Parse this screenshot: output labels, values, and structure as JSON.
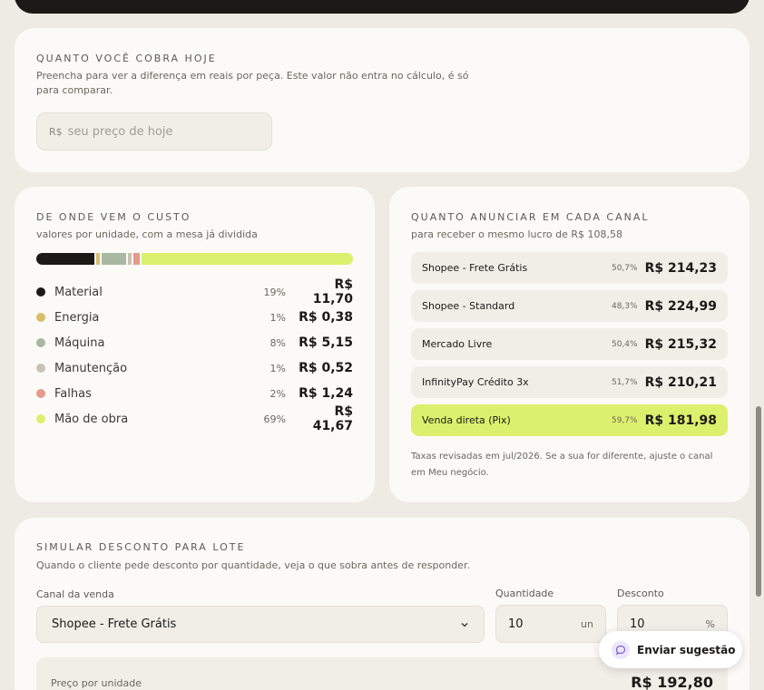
{
  "current_price": {
    "title": "QUANTO VOCÊ COBRA HOJE",
    "description": "Preencha para ver a diferença em reais por peça. Este valor não entra no cálculo, é só para comparar.",
    "prefix": "R$",
    "placeholder": "seu preço de hoje"
  },
  "cost_breakdown": {
    "title": "DE ONDE VEM O CUSTO",
    "subtitle": "valores por unidade, com a mesa já dividida",
    "items": [
      {
        "name": "Material",
        "pct": "19%",
        "value": "R$ 11,70",
        "share": 19,
        "color": "#1c1a17"
      },
      {
        "name": "Energia",
        "pct": "1%",
        "value": "R$ 0,38",
        "share": 1,
        "color": "#d9bd6a"
      },
      {
        "name": "Máquina",
        "pct": "8%",
        "value": "R$ 5,15",
        "share": 8,
        "color": "#a9b8a0"
      },
      {
        "name": "Manutenção",
        "pct": "1%",
        "value": "R$ 0,52",
        "share": 1,
        "color": "#c9c3b5"
      },
      {
        "name": "Falhas",
        "pct": "2%",
        "value": "R$ 1,24",
        "share": 2,
        "color": "#e59a8a"
      },
      {
        "name": "Mão de obra",
        "pct": "69%",
        "value": "R$ 41,67",
        "share": 69,
        "color": "#dbf06c"
      }
    ]
  },
  "channels": {
    "title": "QUANTO ANUNCIAR EM CADA CANAL",
    "subtitle": "para receber o mesmo lucro de R$ 108,58",
    "items": [
      {
        "name": "Shopee - Frete Grátis",
        "pct": "50,7%",
        "value": "R$ 214,23"
      },
      {
        "name": "Shopee - Standard",
        "pct": "48,3%",
        "value": "R$ 224,99"
      },
      {
        "name": "Mercado Livre",
        "pct": "50,4%",
        "value": "R$ 215,32"
      },
      {
        "name": "InfinityPay Crédito 3x",
        "pct": "51,7%",
        "value": "R$ 210,21"
      },
      {
        "name": "Venda direta (Pix)",
        "pct": "59,7%",
        "value": "R$ 181,98",
        "highlighted": true
      }
    ],
    "note": "Taxas revisadas em jul/2026. Se a sua for diferente, ajuste o canal em Meu negócio."
  },
  "simulator": {
    "title": "SIMULAR DESCONTO PARA LOTE",
    "subtitle": "Quando o cliente pede desconto por quantidade, veja o que sobra antes de responder.",
    "channel_label": "Canal da venda",
    "channel_value": "Shopee - Frete Grátis",
    "quantity_label": "Quantidade",
    "quantity_value": "10",
    "quantity_unit": "un",
    "discount_label": "Desconto",
    "discount_value": "10",
    "discount_unit": "%",
    "unit_price_label": "Preço por unidade",
    "unit_price_value": "R$ 192,80"
  },
  "feedback": {
    "label": "Enviar sugestão",
    "icon": "chat-bubble-icon"
  },
  "colors": {
    "accent": "#dbf06c",
    "background": "#eeebe4",
    "card": "#fbfaf7"
  }
}
